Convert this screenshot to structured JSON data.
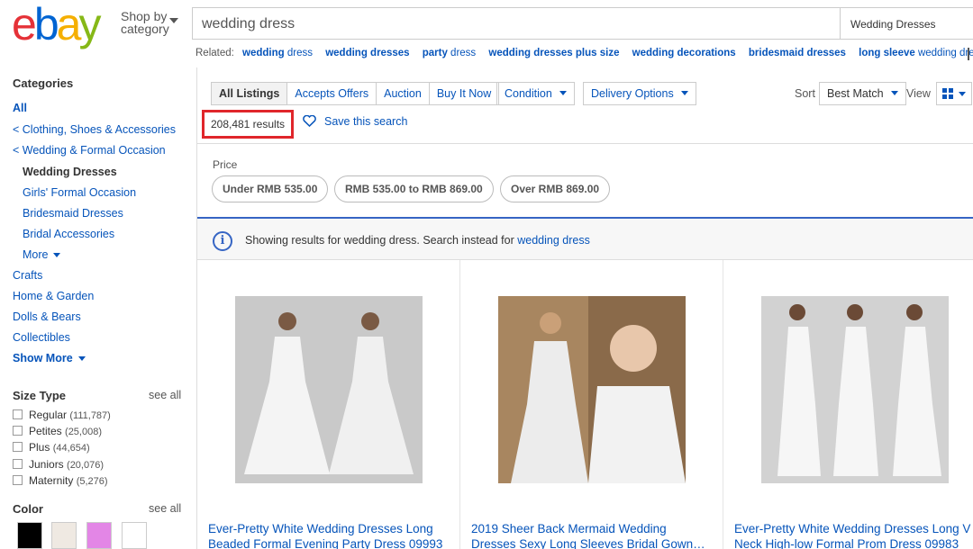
{
  "header": {
    "shop_by": [
      "Shop by",
      "category"
    ],
    "search_value": "wedding dress",
    "category_select": "Wedding Dresses"
  },
  "related": {
    "label": "Related:",
    "items": [
      {
        "bold": "wedding",
        "rest": " dress"
      },
      {
        "bold": "wedding dresses",
        "rest": ""
      },
      {
        "bold": "party",
        "rest": " dress"
      },
      {
        "bold": "wedding dresses plus size",
        "rest": ""
      },
      {
        "bold": "wedding decorations",
        "rest": ""
      },
      {
        "bold": "bridesmaid dresses",
        "rest": ""
      },
      {
        "bold": "long sleeve",
        "rest": " wedding dress"
      }
    ]
  },
  "sidebar": {
    "categories_title": "Categories",
    "all": "All",
    "clothing": "< Clothing, Shoes & Accessories",
    "wedding_formal": "< Wedding & Formal Occasion",
    "current": "Wedding Dresses",
    "subcats": [
      "Girls' Formal Occasion",
      "Bridesmaid Dresses",
      "Bridal Accessories"
    ],
    "more": "More",
    "other_cats": [
      "Crafts",
      "Home & Garden",
      "Dolls & Bears",
      "Collectibles"
    ],
    "show_more": "Show More",
    "size_type": {
      "title": "Size Type",
      "see_all": "see all",
      "options": [
        {
          "label": "Regular",
          "count": "(111,787)"
        },
        {
          "label": "Petites",
          "count": "(25,008)"
        },
        {
          "label": "Plus",
          "count": "(44,654)"
        },
        {
          "label": "Juniors",
          "count": "(20,076)"
        },
        {
          "label": "Maternity",
          "count": "(5,276)"
        }
      ]
    },
    "color": {
      "title": "Color",
      "see_all": "see all",
      "swatches": [
        "#000000",
        "#efe9e2",
        "#e386e6",
        "#ffffff"
      ]
    }
  },
  "toolbar": {
    "tabs": [
      "All Listings",
      "Accepts Offers",
      "Auction",
      "Buy It Now"
    ],
    "condition": "Condition",
    "delivery": "Delivery Options",
    "sort_label": "Sort",
    "sort_value": "Best Match",
    "view_label": "View"
  },
  "results": {
    "count": "208,481 results",
    "save_search": "Save this search"
  },
  "price": {
    "label": "Price",
    "pills": [
      "Under RMB 535.00",
      "RMB 535.00 to RMB 869.00",
      "Over RMB 869.00"
    ]
  },
  "notice": {
    "text": "Showing results for wedding dress. Search instead for ",
    "link": "wedding dress",
    "icon": "i"
  },
  "listings": [
    {
      "title_lines": [
        "Ever-Pretty White Wedding Dresses Long",
        "Beaded Formal Evening Party Dress 09993"
      ]
    },
    {
      "title_lines": [
        "2019 Sheer Back Mermaid Wedding",
        "Dresses Sexy Long Sleeves Bridal Gown…"
      ]
    },
    {
      "title_lines": [
        "Ever-Pretty White Wedding Dresses Long V",
        "Neck High-low Formal Prom Dress 09983"
      ]
    }
  ],
  "colors": {
    "link": "#0654ba",
    "highlight_box": "#e0262b",
    "notice_accent": "#3665c4"
  }
}
